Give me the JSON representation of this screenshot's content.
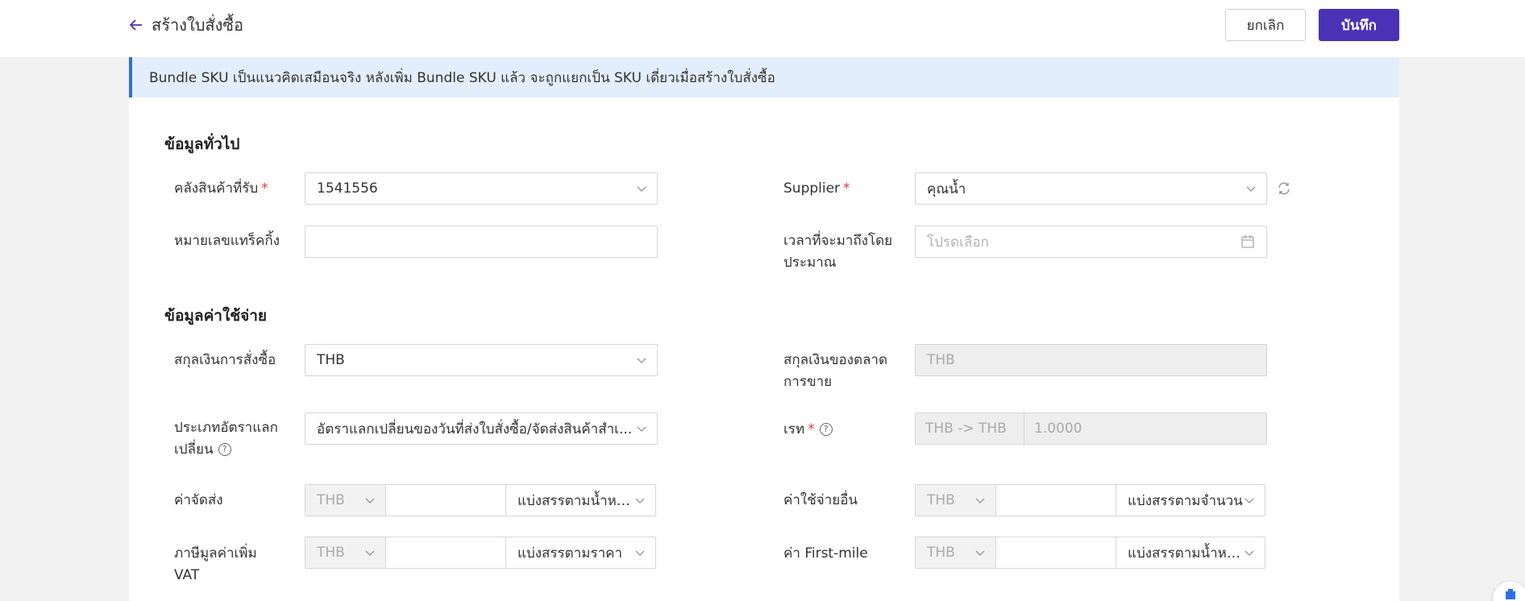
{
  "header": {
    "title": "สร้างใบสั่งซื้อ",
    "cancel_label": "ยกเลิก",
    "save_label": "บันทึก"
  },
  "notice": "Bundle SKU เป็นแนวคิดเสมือนจริง หลังเพิ่ม Bundle SKU แล้ว จะถูกแยกเป็น SKU เดี่ยวเมื่อสร้างใบสั่งซื้อ",
  "general": {
    "title": "ข้อมูลทั่วไป",
    "warehouse_label": "คลังสินค้าที่รับ",
    "warehouse_value": "1541556",
    "supplier_label": "Supplier",
    "supplier_value": "คุณน้ำ",
    "tracking_label": "หมายเลขแทร็คกิ้ง",
    "tracking_value": "",
    "eta_label_1": "เวลาที่จะมาถึงโดย",
    "eta_label_2": "ประมาณ",
    "eta_placeholder": "โปรดเลือก",
    "required_mark": "*"
  },
  "cost": {
    "title": "ข้อมูลค่าใช้จ่าย",
    "po_currency_label": "สกุลเงินการสั่งซื้อ",
    "po_currency_value": "THB",
    "market_currency_label_1": "สกุลเงินของตลาด",
    "market_currency_label_2": "การขาย",
    "market_currency_value": "THB",
    "fx_type_label_1": "ประเภทอัตราแลก",
    "fx_type_label_2": "เปลี่ยน",
    "fx_type_value": "อัตราแลกเปลี่ยนของวันที่ส่งใบสั่งซื้อ/จัดส่งสินค้าสำเ...",
    "rate_label": "เรท",
    "rate_pair": "THB -> THB",
    "rate_value": "1.0000",
    "shipping_label": "ค่าจัดส่ง",
    "shipping_currency": "THB",
    "shipping_split": "แบ่งสรรตามน้ำหน...",
    "other_label": "ค่าใช้จ่ายอื่น",
    "other_currency": "THB",
    "other_split": "แบ่งสรรตามจำนวน",
    "vat_label_1": "ภาษีมูลค่าเพิ่ม",
    "vat_label_2": "VAT",
    "vat_currency": "THB",
    "vat_split": "แบ่งสรรตามราคา",
    "firstmile_label": "ค่า First-mile",
    "firstmile_currency": "THB",
    "firstmile_split": "แบ่งสรรตามน้ำหน..."
  },
  "icons": [
    "arrow-left-icon",
    "chevron-down-icon",
    "refresh-icon",
    "calendar-icon",
    "help-icon",
    "float-action-icon"
  ],
  "colors": {
    "primary": "#4a32b6",
    "notice_bg": "#e3eefc",
    "notice_border": "#2e6fe0",
    "required": "#e03b3b"
  }
}
